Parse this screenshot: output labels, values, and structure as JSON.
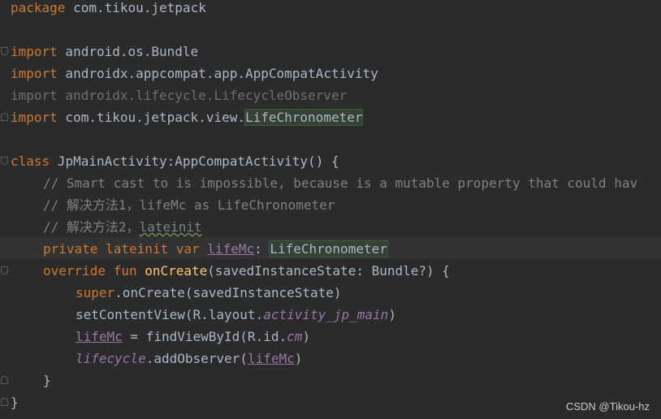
{
  "lines": {
    "l1": {
      "kw": "package",
      "rest": " com.tikou.jetpack"
    },
    "l3": {
      "kw": "import",
      "rest": " android.os.Bundle"
    },
    "l4": {
      "kw": "import",
      "rest": " androidx.appcompat.app.AppCompatActivity"
    },
    "l5": {
      "text": "import androidx.lifecycle.LifecycleObserver"
    },
    "l6": {
      "kw": "import",
      "rest": " com.tikou.jetpack.view.",
      "hl": "LifeChronometer"
    },
    "l8": {
      "kw": "class",
      "rest": " JpMainActivity:AppCompatActivity() {"
    },
    "l9": {
      "text": "// Smart cast to is impossible, because is a mutable property that could hav"
    },
    "l10": {
      "text": "// 解决方法1，lifeMc as LifeChronometer"
    },
    "l11": {
      "prefix": "// 解决方法2，",
      "squig": "lateinit"
    },
    "l12": {
      "kw": "private lateinit var",
      "var": "lifeMc",
      "colon": ": ",
      "hl": "LifeChronometer"
    },
    "l13": {
      "kw": "override fun",
      "fn": "onCreate",
      "rest": "(savedInstanceState: Bundle?) {"
    },
    "l14": {
      "kw": "super",
      "rest": ".onCreate(savedInstanceState)"
    },
    "l15": {
      "pre": "setContentView(R.layout.",
      "prop": "activity_jp_main",
      "post": ")"
    },
    "l16": {
      "var": "lifeMc",
      "pre": " = findViewById(R.id.",
      "prop": "cm",
      "post": ")"
    },
    "l17": {
      "prop": "lifecycle",
      "pre": ".addObserver(",
      "var": "lifeMc",
      "post": ")"
    },
    "l18": {
      "text": "}"
    },
    "l19": {
      "text": "}"
    }
  },
  "watermark": "CSDN @Tikou-hz"
}
